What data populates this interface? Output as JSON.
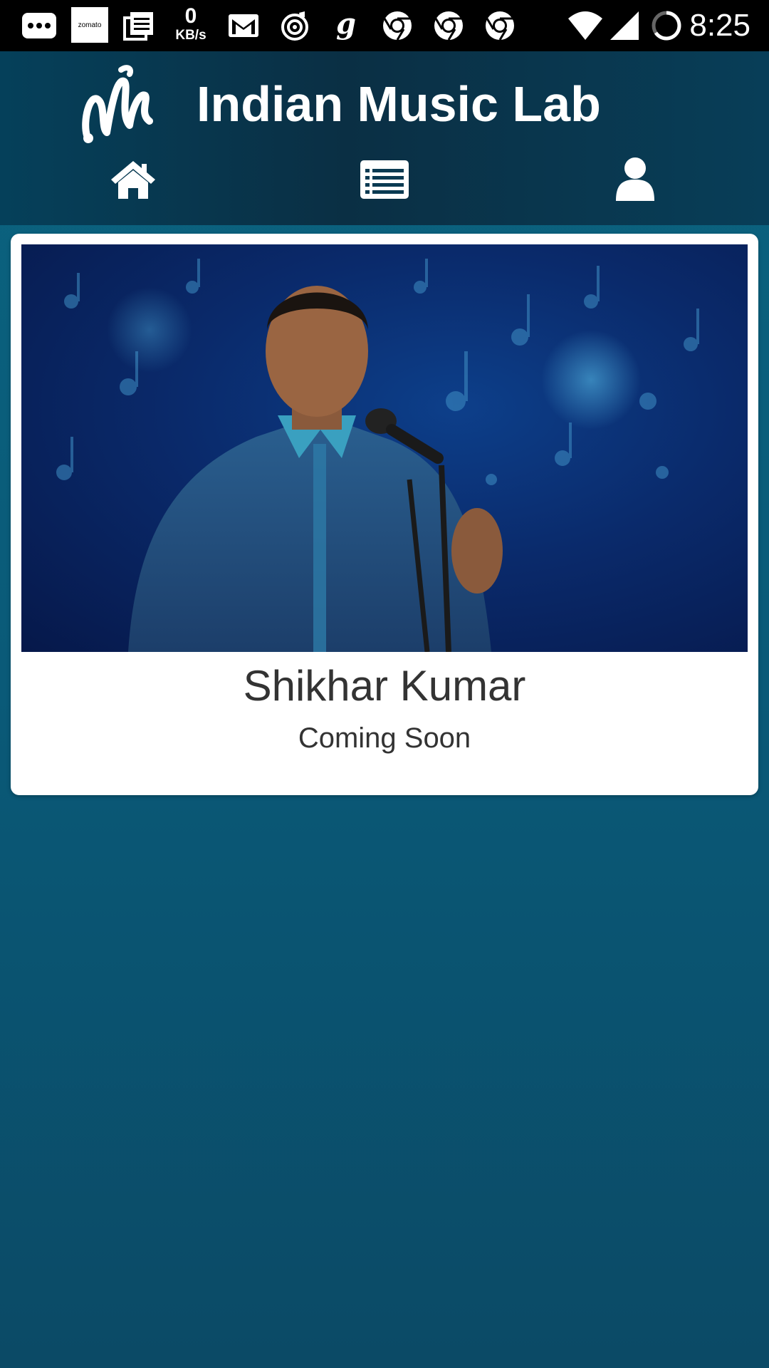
{
  "status_bar": {
    "time": "8:25",
    "net_speed_value": "0",
    "net_speed_unit": "KB/s",
    "zomato_label": "zomato",
    "icons": [
      "more-icon",
      "zomato-icon",
      "notes-icon",
      "net-speed",
      "gmail-icon",
      "music-icon",
      "gaana-icon",
      "chrome-icon",
      "chrome-icon",
      "chrome-icon",
      "wifi-icon",
      "signal-icon",
      "battery-icon"
    ]
  },
  "header": {
    "app_title": "Indian Music Lab",
    "logo": "indian-music-lab-logo"
  },
  "nav": {
    "items": [
      {
        "icon": "home-icon"
      },
      {
        "icon": "list-icon"
      },
      {
        "icon": "user-icon"
      }
    ]
  },
  "artist_card": {
    "name": "Shikhar Kumar",
    "status": "Coming Soon",
    "photo": "singer-performing-photo"
  },
  "colors": {
    "background": "#0a5a78",
    "header": "#0a2f44",
    "card": "#ffffff",
    "text": "#333333"
  }
}
